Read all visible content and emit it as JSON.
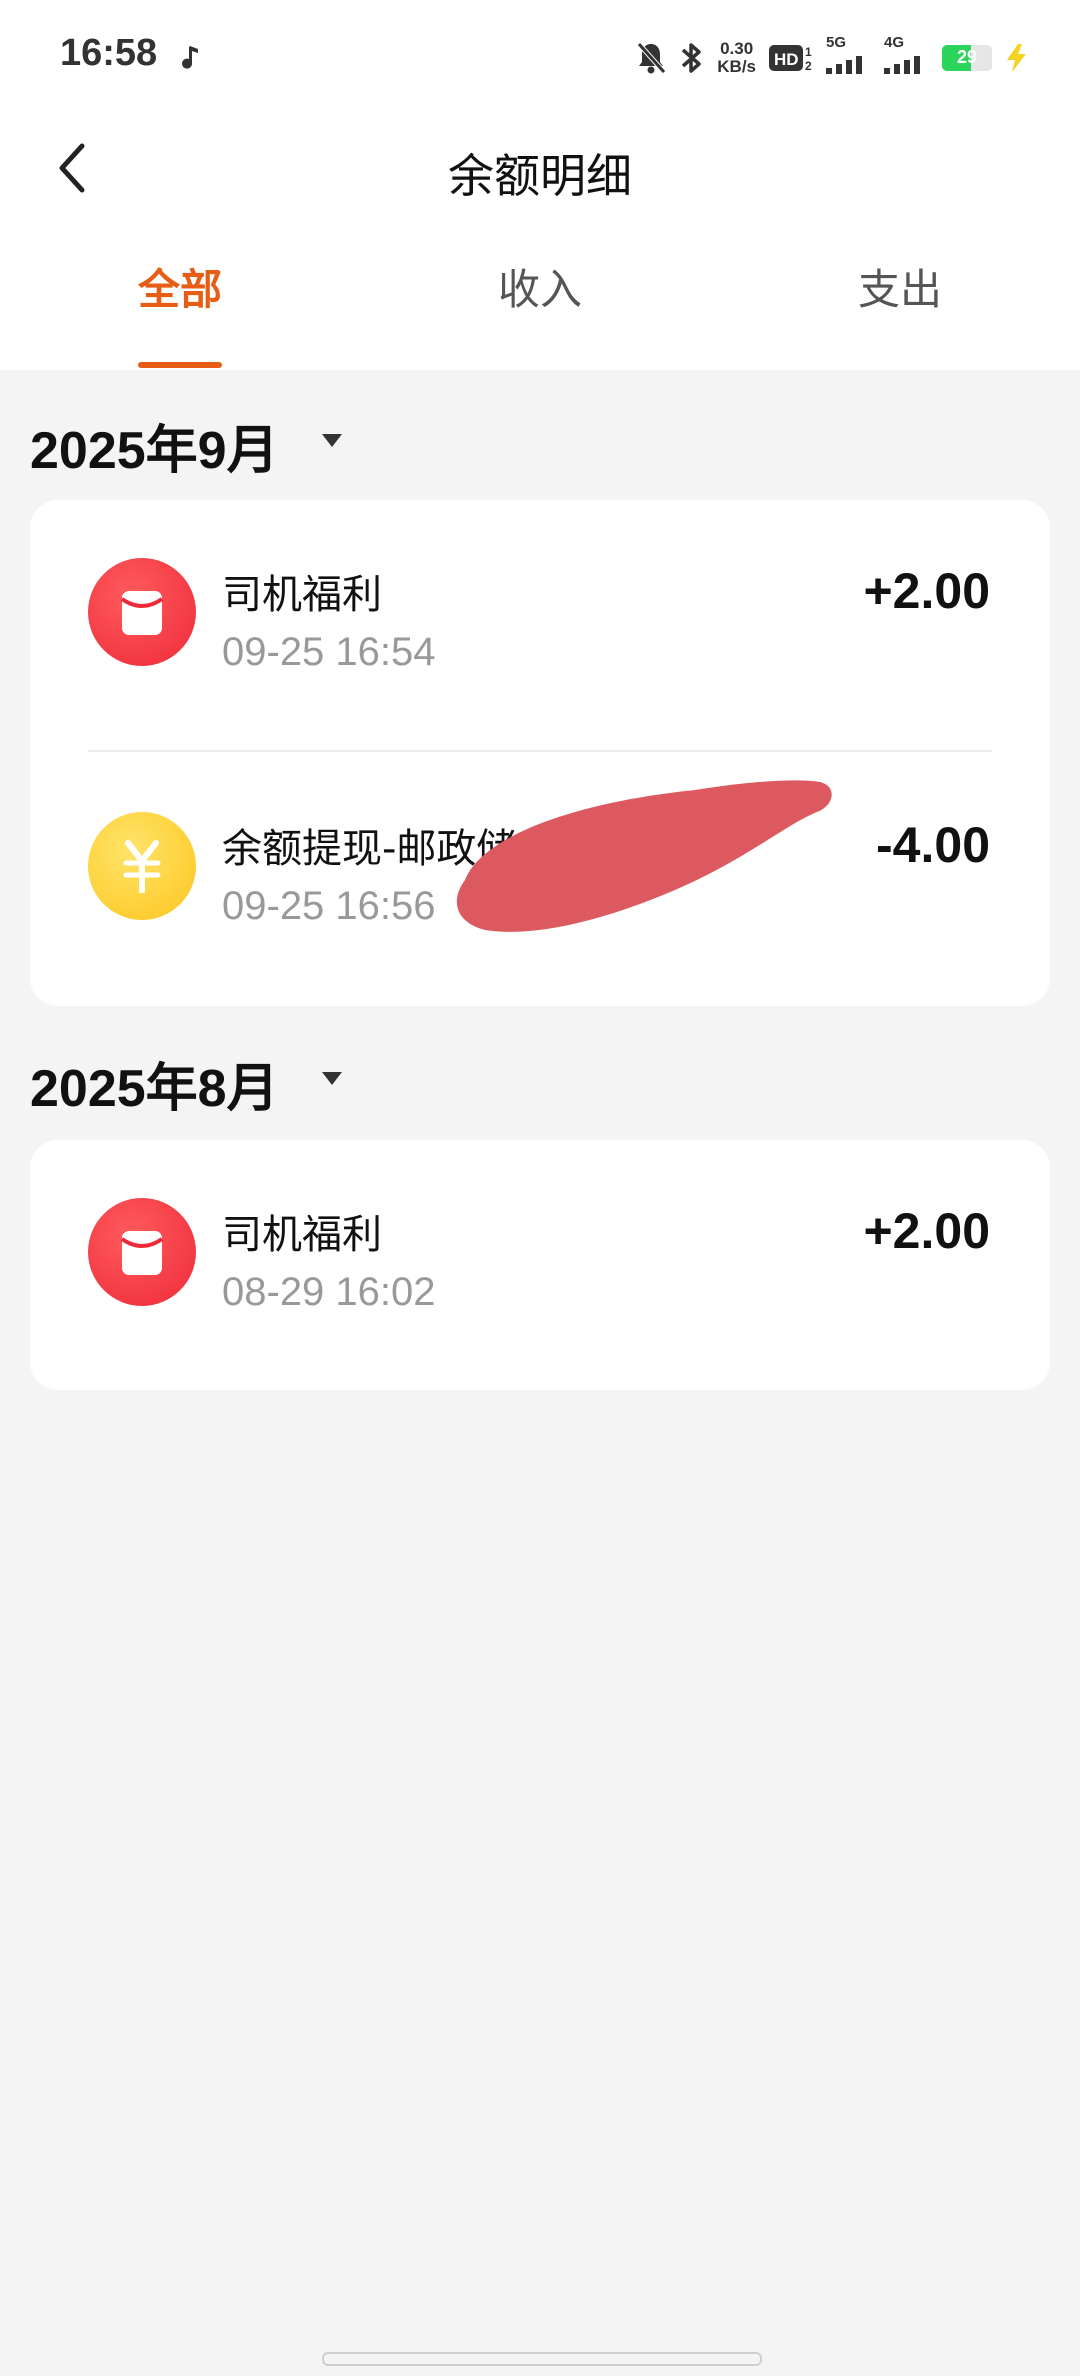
{
  "status_bar": {
    "time": "16:58",
    "speed_value": "0.30",
    "speed_unit": "KB/s",
    "hd_label": "HD",
    "signal1_label": "5G",
    "signal2_label": "4G",
    "battery_level": "29",
    "icons": [
      "music-note-icon",
      "bell-off-icon",
      "bluetooth-icon",
      "hd-icon",
      "signal-5g-icon",
      "signal-4g-icon",
      "battery-icon",
      "charging-icon"
    ]
  },
  "nav": {
    "title": "余额明细",
    "back_icon": "chevron-left-icon"
  },
  "tabs": [
    {
      "label": "全部",
      "active": true
    },
    {
      "label": "收入",
      "active": false
    },
    {
      "label": "支出",
      "active": false
    }
  ],
  "accent_color": "#e85d16",
  "groups": [
    {
      "month": "2025年9月",
      "items": [
        {
          "title": "司机福利",
          "time": "09-25 16:54",
          "amount": "+2.00",
          "icon": "red-envelope-icon"
        },
        {
          "title": "余额提现-邮政储",
          "time": "09-25 16:56",
          "amount": "-4.00",
          "icon": "yuan-coin-icon"
        }
      ]
    },
    {
      "month": "2025年8月",
      "items": [
        {
          "title": "司机福利",
          "time": "08-29 16:02",
          "amount": "+2.00",
          "icon": "red-envelope-icon"
        }
      ]
    }
  ]
}
